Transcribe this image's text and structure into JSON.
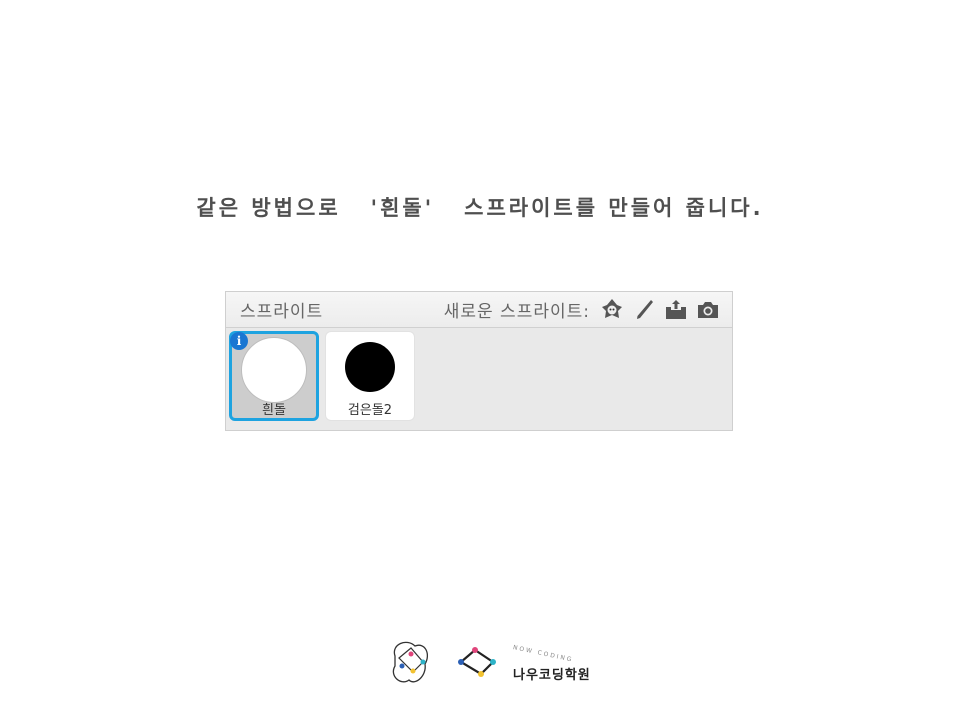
{
  "instruction": {
    "part1": "같은 방법으로",
    "part2": "'흰돌'",
    "part3": "스프라이트를 만들어 줍니다."
  },
  "panel": {
    "title": "스프라이트",
    "new_sprite_label": "새로운 스프라이트:",
    "tools": [
      "sprite-library-icon",
      "paint-brush-icon",
      "upload-icon",
      "camera-icon"
    ]
  },
  "sprites": [
    {
      "name": "흰돌",
      "selected": true,
      "color": "#ffffff"
    },
    {
      "name": "검은돌2",
      "selected": false,
      "color": "#000000"
    }
  ],
  "footer": {
    "brand": "NOW CODING",
    "academy": "나우코딩학원"
  },
  "colors": {
    "selection_border": "#1ea3e0",
    "info_badge": "#1a76d2"
  }
}
